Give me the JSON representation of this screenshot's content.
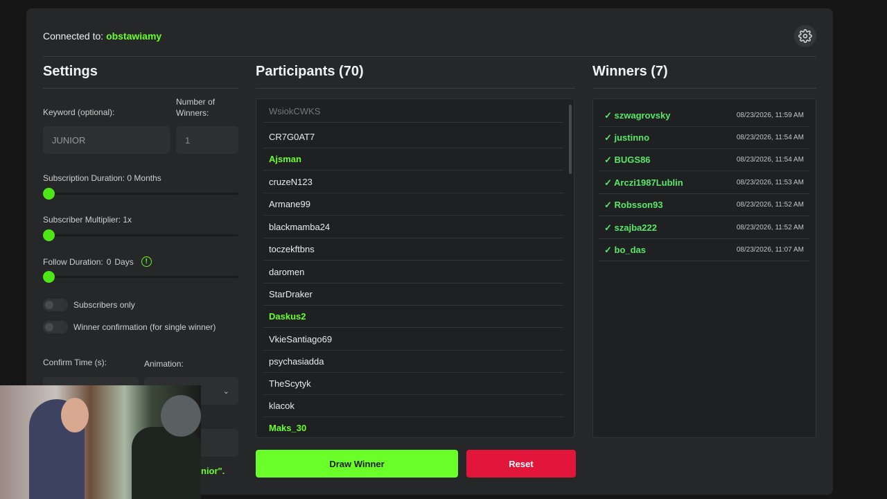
{
  "header": {
    "connected_label": "Connected to:",
    "channel": "obstawiamy"
  },
  "settings": {
    "title": "Settings",
    "keyword_label": "Keyword (optional):",
    "keyword_value": "JUNIOR",
    "winners_label": "Number of Winners:",
    "winners_value": "1",
    "sub_duration_label": "Subscription Duration: 0 Months",
    "sub_duration_value": 0,
    "multiplier_label": "Subscriber Multiplier: 1x",
    "multiplier_value": 0,
    "follow_label_a": "Follow Duration:",
    "follow_value": "0",
    "follow_label_b": "Days",
    "follow_info": "!",
    "subs_only_label": "Subscribers only",
    "subs_only": false,
    "confirm_label": "Winner confirmation (for single winner)",
    "confirm": false,
    "confirm_time_label": "Confirm Time (s):",
    "animation_label": "Animation:",
    "hint_fragment": "nior\"."
  },
  "participants": {
    "title": "Participants (70)",
    "items": [
      {
        "name": "WsiokCWKS",
        "style": "faded"
      },
      {
        "name": "CR7G0AT7",
        "style": ""
      },
      {
        "name": "Ajsman",
        "style": "hl"
      },
      {
        "name": "cruzeN123",
        "style": ""
      },
      {
        "name": "Armane99",
        "style": ""
      },
      {
        "name": "blackmamba24",
        "style": ""
      },
      {
        "name": "toczekftbns",
        "style": ""
      },
      {
        "name": "daromen",
        "style": ""
      },
      {
        "name": "StarDraker",
        "style": ""
      },
      {
        "name": "Daskus2",
        "style": "hl"
      },
      {
        "name": "VkieSantiago69",
        "style": ""
      },
      {
        "name": "psychasiadda",
        "style": ""
      },
      {
        "name": "TheScytyk",
        "style": ""
      },
      {
        "name": "klacok",
        "style": ""
      },
      {
        "name": "Maks_30",
        "style": "hl"
      }
    ]
  },
  "winners": {
    "title": "Winners (7)",
    "items": [
      {
        "name": "✓ szwagrovsky",
        "date": "08/23/2026, 11:59 AM"
      },
      {
        "name": "✓ justinno",
        "date": "08/23/2026, 11:54 AM"
      },
      {
        "name": "✓ BUGS86",
        "date": "08/23/2026, 11:54 AM"
      },
      {
        "name": "✓ Arczi1987Lublin",
        "date": "08/23/2026, 11:53 AM"
      },
      {
        "name": "✓ Robsson93",
        "date": "08/23/2026, 11:52 AM"
      },
      {
        "name": "✓ szajba222",
        "date": "08/23/2026, 11:52 AM"
      },
      {
        "name": "✓ bo_das",
        "date": "08/23/2026, 11:07 AM"
      }
    ]
  },
  "actions": {
    "draw_label": "Draw Winner",
    "reset_label": "Reset"
  },
  "colors": {
    "accent": "#6bff2a",
    "danger": "#e2163a",
    "winner": "#58e86a"
  },
  "icons": {
    "settings": "gear-icon",
    "follow_info": "info-circle-icon",
    "animation_select": "chevron-down-icon"
  }
}
